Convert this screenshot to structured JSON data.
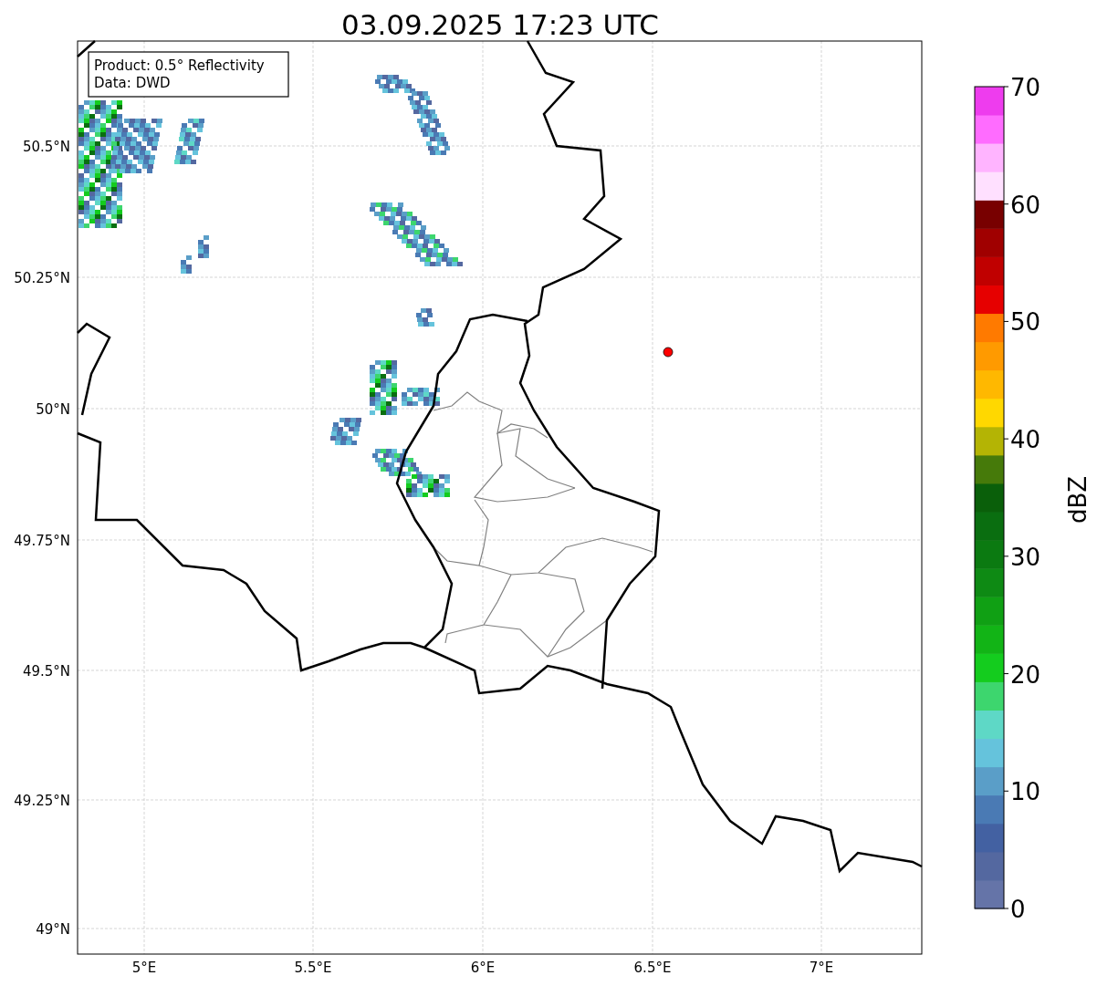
{
  "title": "03.09.2025 17:23 UTC",
  "legend": {
    "lines": [
      "Product: 0.5° Reflectivity",
      "Data: DWD"
    ]
  },
  "y_ticks": [
    "50.5°N",
    "50.25°N",
    "50°N",
    "49.75°N",
    "49.5°N",
    "49.25°N",
    "49°N"
  ],
  "x_ticks": [
    "5°E",
    "5.5°E",
    "6°E",
    "6.5°E",
    "7°E"
  ],
  "colorbar": {
    "label": "dBZ",
    "ticks": [
      "70",
      "60",
      "50",
      "40",
      "30",
      "20",
      "10",
      "0"
    ],
    "bins": [
      {
        "color": "#6574a8"
      },
      {
        "color": "#5468a0"
      },
      {
        "color": "#4361a2"
      },
      {
        "color": "#4a7ab4"
      },
      {
        "color": "#5a9ec8"
      },
      {
        "color": "#65c3dc"
      },
      {
        "color": "#5ed8c6"
      },
      {
        "color": "#3dd66e"
      },
      {
        "color": "#14cc1e"
      },
      {
        "color": "#12b416"
      },
      {
        "color": "#10a014"
      },
      {
        "color": "#0e8a14"
      },
      {
        "color": "#0b7a11"
      },
      {
        "color": "#0a6e10"
      },
      {
        "color": "#0a5f0a"
      },
      {
        "color": "#467a0a"
      },
      {
        "color": "#b4b404"
      },
      {
        "color": "#ffd800"
      },
      {
        "color": "#ffb800"
      },
      {
        "color": "#ff9a00"
      },
      {
        "color": "#ff7a00"
      },
      {
        "color": "#e60000"
      },
      {
        "color": "#c00000"
      },
      {
        "color": "#a00000"
      },
      {
        "color": "#780000"
      },
      {
        "color": "#ffe0ff"
      },
      {
        "color": "#ffb4ff"
      },
      {
        "color": "#ff6cff"
      },
      {
        "color": "#ee3cee"
      }
    ]
  }
}
